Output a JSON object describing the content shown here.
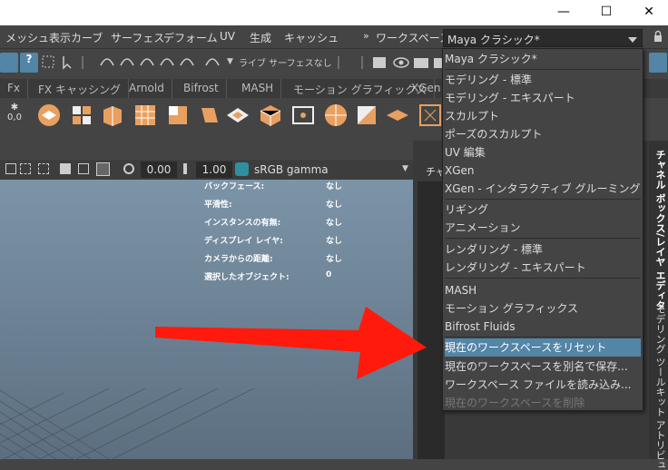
{
  "menubar": {
    "items": [
      "メッシュ表示",
      "カーブ",
      "サーフェス",
      "デフォーム",
      "UV",
      "生成",
      "キャッシュ"
    ],
    "workspace_label": "ワークスペース:",
    "workspace_value": "Maya クラシック*",
    "overflow": "»"
  },
  "toolbar": {
    "live_label": "ライブ サーフェスなし"
  },
  "shelf_tabs": [
    "Fx",
    "FX キャッシング",
    "Arnold",
    "Bifrost",
    "MASH",
    "モーション グラフィックス",
    "XGen"
  ],
  "viewport_bar": {
    "exposure": "0.00",
    "gamma": "1.00",
    "colorspace": "sRGB gamma"
  },
  "hud": [
    {
      "label": "バックフェース:",
      "value": "なし"
    },
    {
      "label": "平滑性:",
      "value": "なし"
    },
    {
      "label": "インスタンスの有無:",
      "value": "なし"
    },
    {
      "label": "ディスプレイ レイヤ:",
      "value": "なし"
    },
    {
      "label": "カメラからの距離:",
      "value": "なし"
    },
    {
      "label": "選択したオブジェクト:",
      "value": "0"
    }
  ],
  "right_panel": {
    "label": "チャ"
  },
  "side_tabs": [
    "チャネル ボックス/レイヤ エディタ",
    "モデリング ツールキット",
    "アトリビュ"
  ],
  "dropdown": {
    "items": [
      "Maya クラシック*",
      "モデリング - 標準",
      "モデリング - エキスパート",
      "スカルプト",
      "ポーズのスカルプト",
      "UV 編集",
      "XGen",
      "XGen - インタラクティブ グルーミング",
      "リギング",
      "アニメーション",
      "レンダリング - 標準",
      "レンダリング - エキスパート",
      "MASH",
      "モーション グラフィックス",
      "Bifrost Fluids",
      "現在のワークスペースをリセット",
      "現在のワークスペースを別名で保存...",
      "ワークスペース ファイルを読み込み...",
      "現在のワークスペースを削除"
    ]
  },
  "colors": {
    "accent": "#5285a6",
    "arrow": "#ff1a0d",
    "shelf_orange": "#e8a060"
  }
}
